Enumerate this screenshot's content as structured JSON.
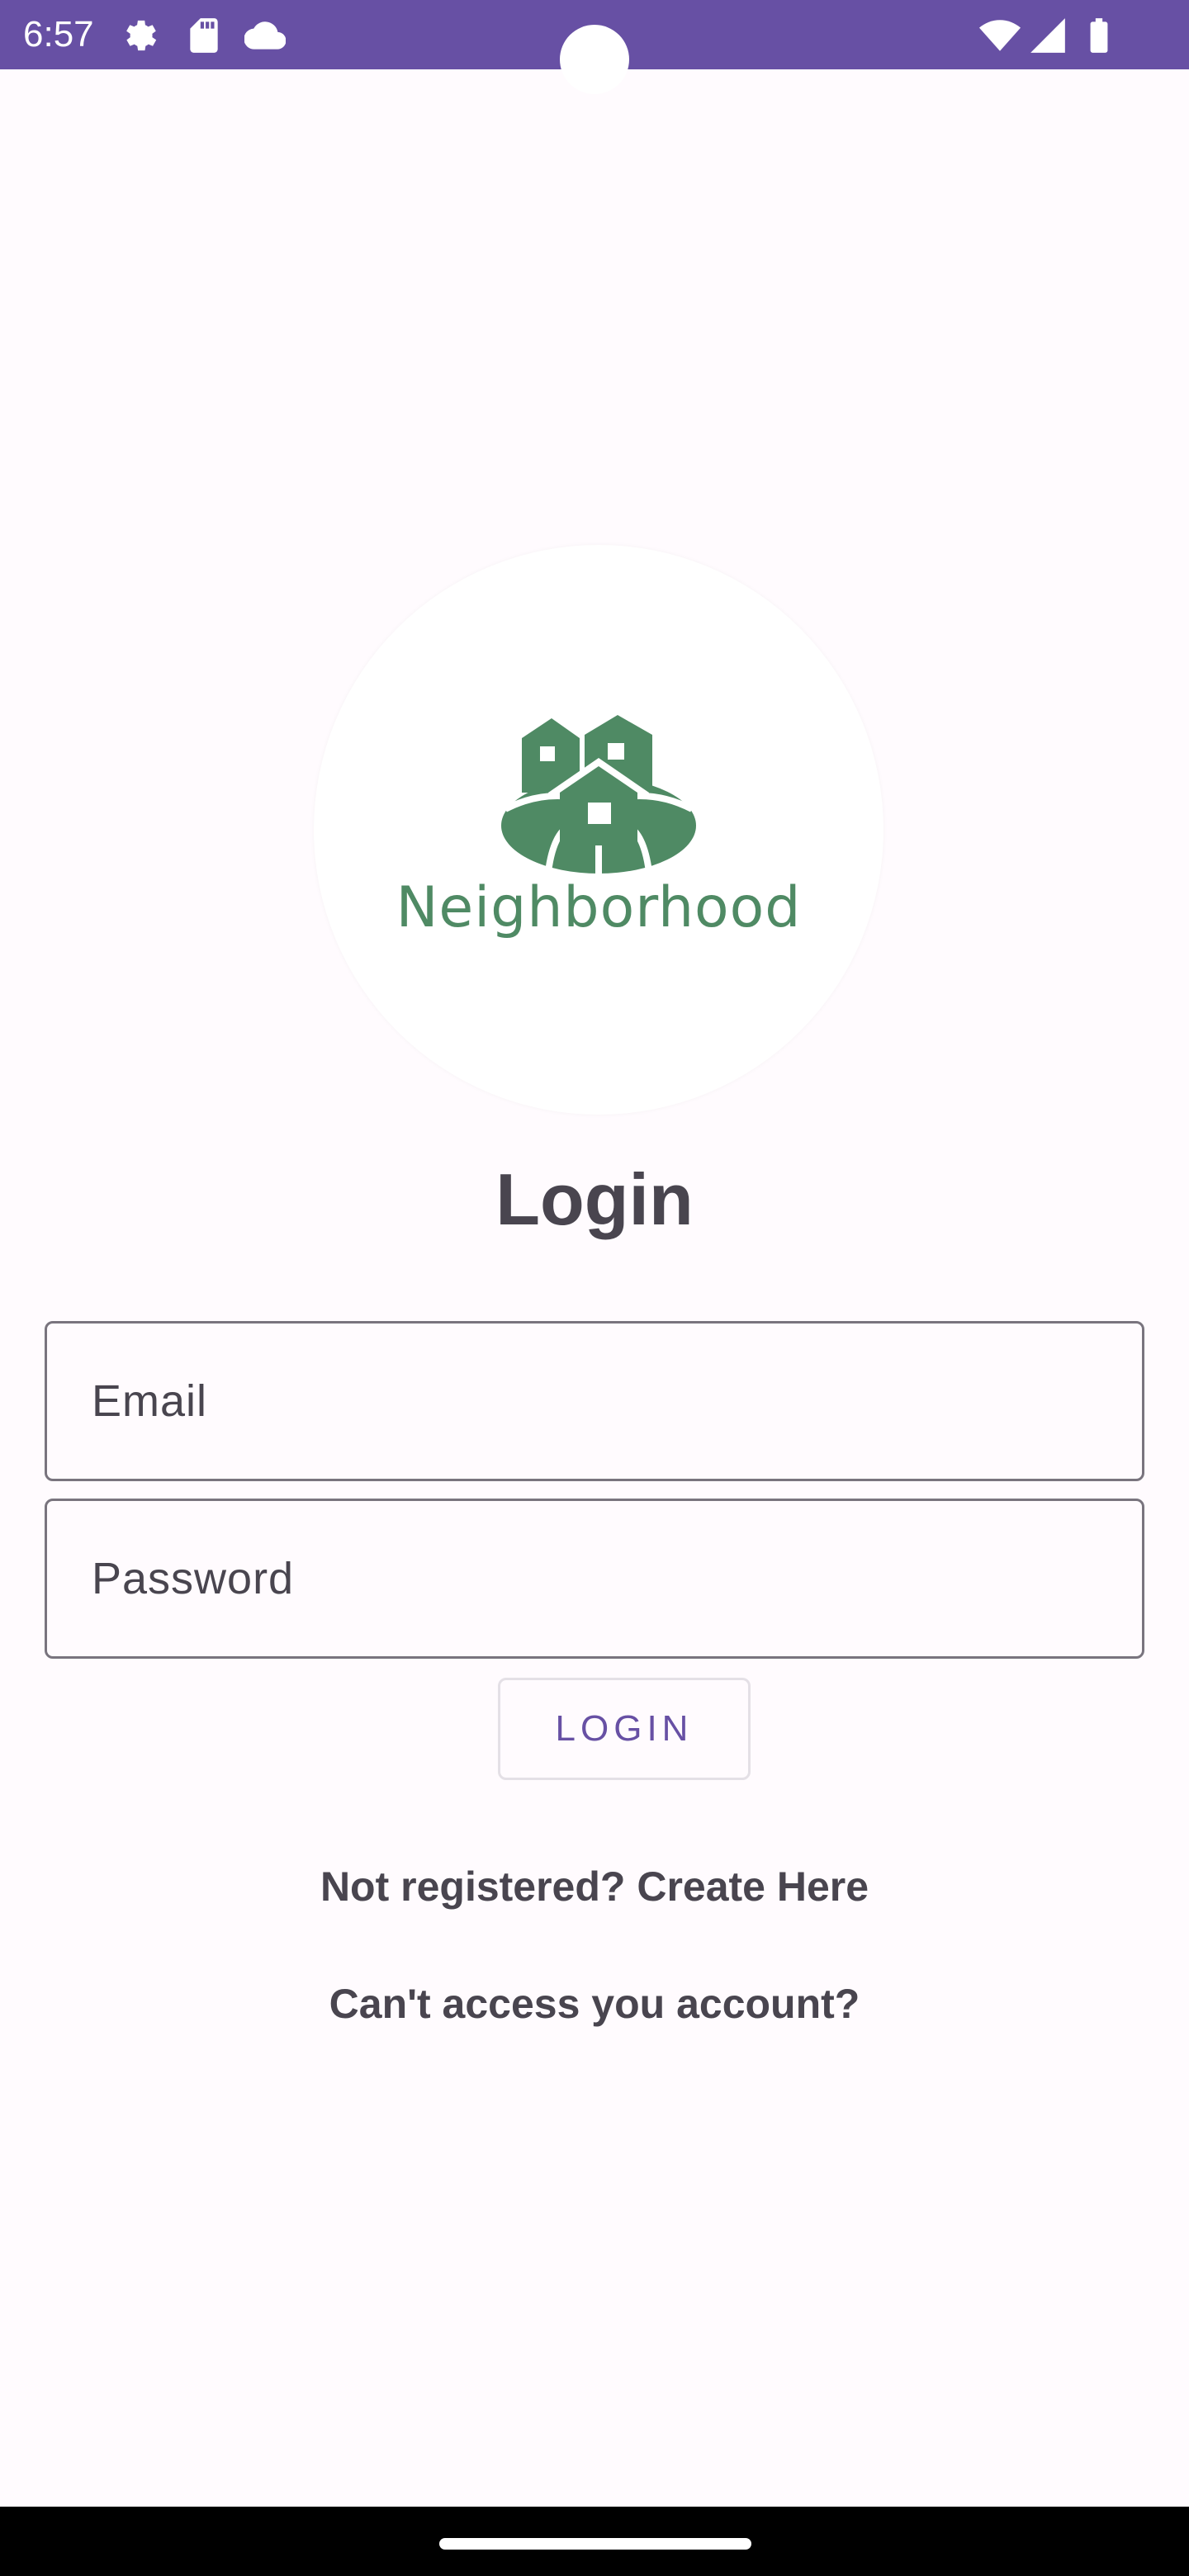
{
  "status_bar": {
    "time": "6:57",
    "left_icons": [
      "gear-icon",
      "sd-card-icon",
      "cloud-icon"
    ],
    "right_icons": [
      "wifi-icon",
      "signal-icon",
      "battery-icon"
    ]
  },
  "logo": {
    "text": "Neighborhood",
    "icon": "houses-logo-icon",
    "color": "#4f8a64"
  },
  "title": "Login",
  "form": {
    "email_placeholder": "Email",
    "email_value": "",
    "password_placeholder": "Password",
    "password_value": ""
  },
  "login_button_label": "LOGIN",
  "links": {
    "register": "Not registered? Create Here",
    "recover": "Can't access you account?"
  },
  "colors": {
    "status_bar": "#6750a4",
    "accent": "#6750a4",
    "background": "#fffbfe",
    "text": "#49454f"
  }
}
